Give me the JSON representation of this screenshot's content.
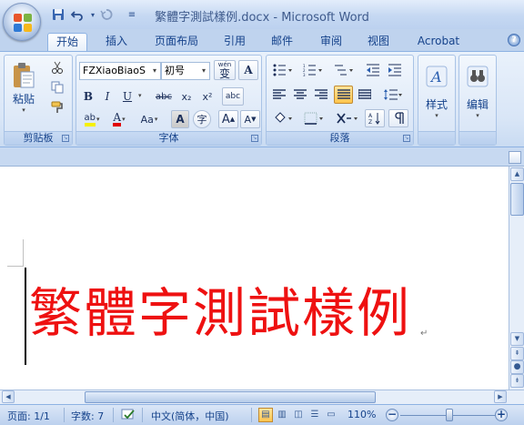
{
  "window": {
    "title": "繁體字測試樣例.docx - Microsoft Word"
  },
  "quick_access": {
    "save_icon": "save-icon",
    "undo_icon": "undo-icon",
    "redo_icon": "redo-icon"
  },
  "tabs": [
    {
      "label": "开始",
      "active": true
    },
    {
      "label": "插入"
    },
    {
      "label": "页面布局"
    },
    {
      "label": "引用"
    },
    {
      "label": "邮件"
    },
    {
      "label": "审阅"
    },
    {
      "label": "视图"
    },
    {
      "label": "Acrobat"
    }
  ],
  "ribbon": {
    "clipboard": {
      "label": "剪贴板",
      "paste_label": "粘贴"
    },
    "font": {
      "label": "字体",
      "font_name": "FZXiaoBiaoS",
      "font_size": "初号",
      "wen_label": "wén",
      "wen_char": "变",
      "bold": "B",
      "italic": "I",
      "underline": "U",
      "strike": "abc",
      "subscript": "x₂",
      "superscript": "x²",
      "aa_label": "Aa",
      "grow": "A",
      "shrink": "A",
      "border_char": "A",
      "circle_char": "字",
      "highlight": "ab",
      "color_a": "A",
      "clear": "A",
      "phonetic": "abc"
    },
    "paragraph": {
      "label": "段落"
    },
    "styles": {
      "label": "样式"
    },
    "editing": {
      "label": "编辑"
    }
  },
  "document": {
    "body_text": "繁體字測試樣例",
    "text_color": "#ee1111",
    "para_mark": "↵"
  },
  "statusbar": {
    "page": "页面: 1/1",
    "words": "字数: 7",
    "language": "中文(简体，中国)",
    "zoom": "110%",
    "zoom_percent": 110
  },
  "colors": {
    "accent": "#15428b",
    "ribbon_bg": "#d9e6f7",
    "pressed": "#ffc54e"
  }
}
